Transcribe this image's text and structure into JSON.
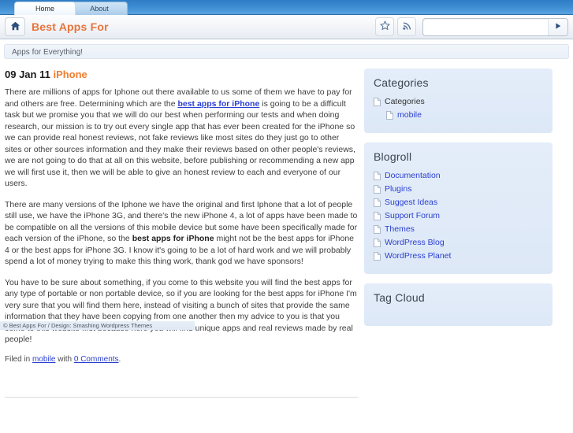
{
  "browser": {
    "tabs": [
      {
        "label": "Home",
        "active": true
      },
      {
        "label": "About",
        "active": false
      }
    ],
    "home_icon": "home-icon",
    "site_title": "Best Apps For",
    "bookmark_icon": "star-icon",
    "feed_icon": "rss-icon",
    "search": {
      "value": "",
      "placeholder": ""
    },
    "go_icon": "play-arrow-icon"
  },
  "site": {
    "tagline": "Apps for Everything!",
    "accent_orange": "#e8743b",
    "link_blue": "#2a3fd0",
    "widget_bg": "#e0ebf8"
  },
  "post": {
    "date": "09 Jan 11",
    "category": "iPhone",
    "paragraphs": [
      {
        "parts": [
          {
            "type": "text",
            "text": "There are millions of apps for Iphone out there available to us some of them we have to pay for and others are free. Determining which are the "
          },
          {
            "type": "link",
            "text": "best apps for iPhone"
          },
          {
            "type": "text",
            "text": " is going to be a difficult task but we promise you that we will do our best when performing our tests and when doing research, our mission is to try out every single app that has ever been created for the iPhone so we can provide real honest reviews, not fake reviews like most sites do they just go to other sites or other sources information and they make their reviews based on other people's reviews, we are not going to do that at all on this website, before publishing or recommending a new app we will first use it, then we will be able to give an honest review to each and everyone of our users."
          }
        ]
      },
      {
        "parts": [
          {
            "type": "text",
            "text": "There are many versions of the Iphone we have the original and first Iphone that a lot of people still use, we have the iPhone 3G, and there's the new iPhone 4, a lot of apps have been made to be compatible on all the versions of this mobile device but some have been specifically made for each version of the iPhone, so the "
          },
          {
            "type": "bold",
            "text": "best apps for iPhone"
          },
          {
            "type": "text",
            "text": " might not be the best apps for iPhone 4 or the best apps for iPhone 3G. I know it's going to be a lot of hard work and we will probably spend a lot of money trying to make this thing work, thank god we have sponsors!"
          }
        ]
      },
      {
        "parts": [
          {
            "type": "text",
            "text": "You have to be sure about something, if you come to this website you will find the best apps for any type of portable or non portable device, so if you are looking for the best apps for iPhone I'm very sure that you will find them here, instead of visiting a bunch of sites that provide the same information that they have been copying from one another then my advice to you is that you come to this website first because here you will find unique apps and real reviews made by real people!"
          }
        ]
      }
    ],
    "meta": {
      "filed_in_label": "Filed in",
      "category_link": "mobile",
      "with_label": "with",
      "comments_link": "0 Comments",
      "trailing": "."
    }
  },
  "sidebar": {
    "widgets": [
      {
        "title": "Categories",
        "items": [
          {
            "label": "Categories",
            "nested": false,
            "link": false
          },
          {
            "label": "mobile",
            "nested": true,
            "link": true
          }
        ]
      },
      {
        "title": "Blogroll",
        "items": [
          {
            "label": "Documentation",
            "nested": false,
            "link": true
          },
          {
            "label": "Plugins",
            "nested": false,
            "link": true
          },
          {
            "label": "Suggest Ideas",
            "nested": false,
            "link": true
          },
          {
            "label": "Support Forum",
            "nested": false,
            "link": true
          },
          {
            "label": "Themes",
            "nested": false,
            "link": true
          },
          {
            "label": "WordPress Blog",
            "nested": false,
            "link": true
          },
          {
            "label": "WordPress Planet",
            "nested": false,
            "link": true
          }
        ]
      },
      {
        "title": "Tag Cloud",
        "items": []
      }
    ]
  },
  "footer": {
    "text": "© Best Apps For / Design: Smashing Wordpress Themes"
  }
}
